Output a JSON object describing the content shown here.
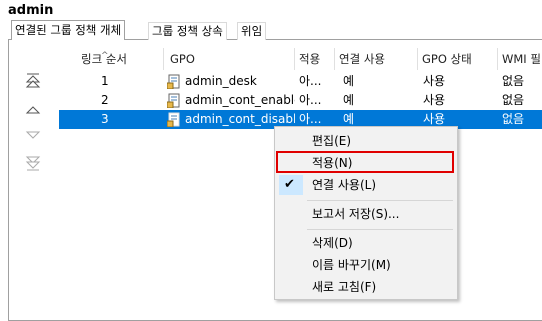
{
  "window": {
    "title": "admin"
  },
  "tabs": [
    {
      "label": "연결된 그룹 정책 개체"
    },
    {
      "label": "그룹 정책 상속"
    },
    {
      "label": "위임"
    }
  ],
  "columns": [
    "링크 순서",
    "GPO",
    "적용",
    "연결 사용",
    "GPO 상태",
    "WMI 필"
  ],
  "rows": [
    {
      "order": "1",
      "gpo": "admin_desk",
      "enforced": "아...",
      "link_enabled": "예",
      "status": "사용",
      "wmi": "없음",
      "selected": false
    },
    {
      "order": "2",
      "gpo": "admin_cont_enable",
      "enforced": "아...",
      "link_enabled": "예",
      "status": "사용",
      "wmi": "없음",
      "selected": false
    },
    {
      "order": "3",
      "gpo": "admin_cont_disable",
      "enforced": "아...",
      "link_enabled": "예",
      "status": "사용",
      "wmi": "없음",
      "selected": true
    }
  ],
  "side_buttons": [
    "move-to-top-icon",
    "move-up-icon",
    "move-down-icon",
    "move-to-bottom-icon"
  ],
  "context_menu": {
    "items": [
      {
        "label": "편집(E)"
      },
      {
        "label": "적용(N)",
        "highlighted": true
      },
      {
        "label": "연결 사용(L)",
        "checked": true
      },
      {
        "label": "보고서 저장(S)..."
      },
      {
        "label": "삭제(D)"
      },
      {
        "label": "이름 바꾸기(M)"
      },
      {
        "label": "새로 고침(F)"
      }
    ],
    "check_glyph": "✔"
  },
  "colors": {
    "selection": "#0078d7",
    "highlight_box": "#e00000",
    "menu_bg": "#f2f2f2"
  }
}
